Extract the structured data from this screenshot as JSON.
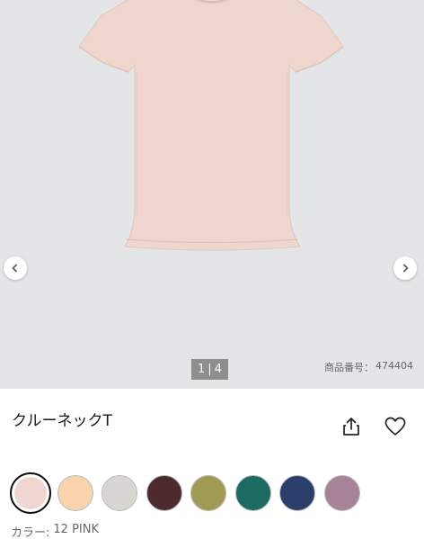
{
  "gallery": {
    "current_page": "1",
    "separator": "|",
    "total_pages": "4",
    "product_number_label": "商品番号：",
    "product_number": "474404",
    "image_bg": "#e3e5e7",
    "shirt_color": "#efd6cf"
  },
  "product": {
    "title": "クルーネックT",
    "share_icon": "share-icon",
    "favorite_icon": "heart-icon"
  },
  "colors": {
    "swatches": [
      "#efd6d1",
      "#f9d4ad",
      "#d8d6d3",
      "#4d2a2b",
      "#a09a55",
      "#1d6a63",
      "#2c3f6b",
      "#a78397"
    ],
    "selected_index": 0,
    "label": "カラー:",
    "selected_name": "12 PINK"
  }
}
